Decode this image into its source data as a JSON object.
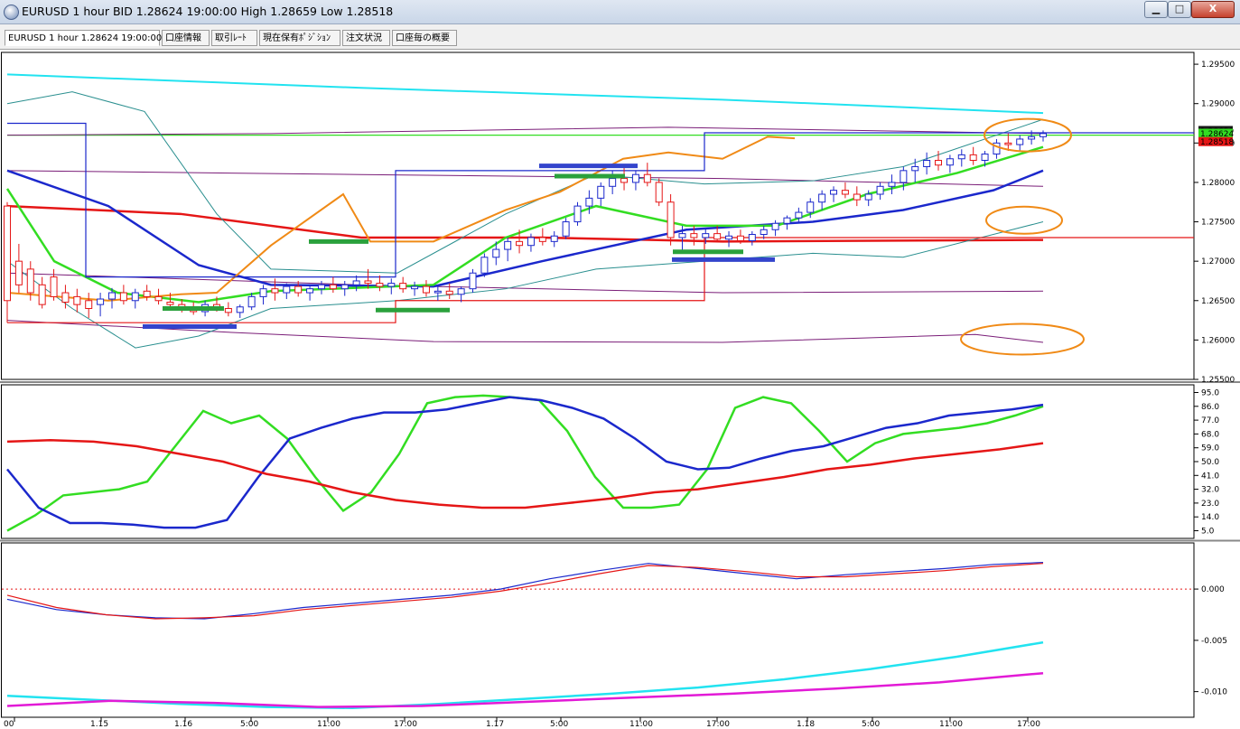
{
  "window": {
    "title": "EURUSD 1 hour BID 1.28624 19:00:00 High 1.28659 Low 1.28518",
    "minimize_glyph": "▁",
    "maximize_glyph": "□",
    "close_glyph": "X"
  },
  "tabs": [
    {
      "label": "EURUSD 1 hour 1.28624 19:00:00",
      "active": true
    },
    {
      "label": "口座情報",
      "active": false
    },
    {
      "label": "取引ﾚｰﾄ",
      "active": false
    },
    {
      "label": "現在保有ﾎﾟｼﾞｼｮﾝ",
      "active": false
    },
    {
      "label": "注文状況",
      "active": false
    },
    {
      "label": "口座毎の概要",
      "active": false
    }
  ],
  "chart_data": [
    {
      "type": "candlestick",
      "panel": "price",
      "ylim": [
        1.255,
        1.2965
      ],
      "y_ticks": [
        "1.29500",
        "1.29000",
        "1.28500",
        "1.28000",
        "1.27500",
        "1.27000",
        "1.26500",
        "1.26000",
        "1.25500"
      ],
      "current_price_labels": [
        "1.28659",
        "1.28624",
        "1.28518"
      ],
      "candles": [
        [
          1.277,
          1.2775,
          1.2622,
          1.265
        ],
        [
          1.27,
          1.2722,
          1.266,
          1.267
        ],
        [
          1.269,
          1.27,
          1.265,
          1.266
        ],
        [
          1.267,
          1.268,
          1.264,
          1.2645
        ],
        [
          1.268,
          1.269,
          1.265,
          1.2655
        ],
        [
          1.266,
          1.267,
          1.264,
          1.2648
        ],
        [
          1.2655,
          1.2665,
          1.2635,
          1.2645
        ],
        [
          1.265,
          1.266,
          1.2628,
          1.264
        ],
        [
          1.2645,
          1.266,
          1.263,
          1.2652
        ],
        [
          1.2652,
          1.2666,
          1.264,
          1.266
        ],
        [
          1.266,
          1.267,
          1.2645,
          1.265
        ],
        [
          1.265,
          1.2665,
          1.264,
          1.266
        ],
        [
          1.2662,
          1.267,
          1.265,
          1.2655
        ],
        [
          1.2655,
          1.2665,
          1.2645,
          1.265
        ],
        [
          1.2648,
          1.266,
          1.2638,
          1.2645
        ],
        [
          1.2645,
          1.2652,
          1.2635,
          1.264
        ],
        [
          1.264,
          1.2648,
          1.2632,
          1.2636
        ],
        [
          1.2636,
          1.265,
          1.263,
          1.2645
        ],
        [
          1.2645,
          1.2655,
          1.2636,
          1.264
        ],
        [
          1.264,
          1.2648,
          1.263,
          1.2635
        ],
        [
          1.2635,
          1.2645,
          1.2628,
          1.2642
        ],
        [
          1.2642,
          1.266,
          1.2638,
          1.2655
        ],
        [
          1.2655,
          1.267,
          1.2645,
          1.2665
        ],
        [
          1.2665,
          1.2678,
          1.265,
          1.266
        ],
        [
          1.266,
          1.2672,
          1.2652,
          1.2668
        ],
        [
          1.2668,
          1.2675,
          1.2655,
          1.266
        ],
        [
          1.266,
          1.267,
          1.265,
          1.2665
        ],
        [
          1.2665,
          1.2675,
          1.2658,
          1.267
        ],
        [
          1.267,
          1.268,
          1.266,
          1.2665
        ],
        [
          1.2665,
          1.2675,
          1.2656,
          1.267
        ],
        [
          1.267,
          1.2682,
          1.2662,
          1.2675
        ],
        [
          1.2675,
          1.269,
          1.2665,
          1.2672
        ],
        [
          1.2672,
          1.2682,
          1.2662,
          1.2668
        ],
        [
          1.2668,
          1.2678,
          1.2658,
          1.2672
        ],
        [
          1.2672,
          1.268,
          1.266,
          1.2665
        ],
        [
          1.2665,
          1.2674,
          1.2656,
          1.2668
        ],
        [
          1.2668,
          1.2676,
          1.2655,
          1.266
        ],
        [
          1.266,
          1.2668,
          1.265,
          1.2662
        ],
        [
          1.2662,
          1.2672,
          1.2652,
          1.2658
        ],
        [
          1.2658,
          1.2668,
          1.2648,
          1.2665
        ],
        [
          1.2665,
          1.269,
          1.266,
          1.2685
        ],
        [
          1.2685,
          1.271,
          1.268,
          1.2705
        ],
        [
          1.2705,
          1.2725,
          1.2695,
          1.2715
        ],
        [
          1.2715,
          1.273,
          1.27,
          1.2725
        ],
        [
          1.2725,
          1.274,
          1.271,
          1.272
        ],
        [
          1.272,
          1.2735,
          1.2712,
          1.273
        ],
        [
          1.273,
          1.2742,
          1.272,
          1.2725
        ],
        [
          1.2725,
          1.2738,
          1.2718,
          1.2732
        ],
        [
          1.2732,
          1.2755,
          1.2728,
          1.275
        ],
        [
          1.275,
          1.2775,
          1.2745,
          1.277
        ],
        [
          1.277,
          1.279,
          1.276,
          1.278
        ],
        [
          1.278,
          1.28,
          1.277,
          1.2795
        ],
        [
          1.2795,
          1.2815,
          1.2785,
          1.2805
        ],
        [
          1.2805,
          1.282,
          1.279,
          1.28
        ],
        [
          1.28,
          1.2815,
          1.279,
          1.281
        ],
        [
          1.281,
          1.2825,
          1.2795,
          1.28
        ],
        [
          1.28,
          1.2805,
          1.277,
          1.2775
        ],
        [
          1.2775,
          1.2785,
          1.272,
          1.273
        ],
        [
          1.273,
          1.2745,
          1.2712,
          1.2735
        ],
        [
          1.2735,
          1.2745,
          1.272,
          1.273
        ],
        [
          1.273,
          1.2742,
          1.2722,
          1.2735
        ],
        [
          1.2735,
          1.2745,
          1.2725,
          1.2728
        ],
        [
          1.2728,
          1.2738,
          1.2718,
          1.2732
        ],
        [
          1.2732,
          1.274,
          1.2722,
          1.2726
        ],
        [
          1.2726,
          1.2738,
          1.272,
          1.2734
        ],
        [
          1.2734,
          1.2745,
          1.2728,
          1.274
        ],
        [
          1.274,
          1.2752,
          1.2732,
          1.2748
        ],
        [
          1.2748,
          1.2758,
          1.274,
          1.2755
        ],
        [
          1.2755,
          1.2768,
          1.2748,
          1.2762
        ],
        [
          1.2762,
          1.278,
          1.2755,
          1.2775
        ],
        [
          1.2775,
          1.279,
          1.2765,
          1.2785
        ],
        [
          1.2785,
          1.2795,
          1.2775,
          1.279
        ],
        [
          1.279,
          1.28,
          1.278,
          1.2785
        ],
        [
          1.2785,
          1.2795,
          1.277,
          1.2778
        ],
        [
          1.2778,
          1.279,
          1.277,
          1.2785
        ],
        [
          1.2785,
          1.28,
          1.2778,
          1.2795
        ],
        [
          1.2795,
          1.281,
          1.2785,
          1.28
        ],
        [
          1.28,
          1.282,
          1.279,
          1.2815
        ],
        [
          1.2815,
          1.283,
          1.28,
          1.282
        ],
        [
          1.282,
          1.2838,
          1.281,
          1.2828
        ],
        [
          1.2828,
          1.284,
          1.2815,
          1.2822
        ],
        [
          1.2822,
          1.2835,
          1.2812,
          1.283
        ],
        [
          1.283,
          1.2842,
          1.282,
          1.2835
        ],
        [
          1.2835,
          1.2845,
          1.2822,
          1.2828
        ],
        [
          1.2828,
          1.284,
          1.282,
          1.2836
        ],
        [
          1.2836,
          1.2855,
          1.283,
          1.285
        ],
        [
          1.285,
          1.2862,
          1.284,
          1.2848
        ],
        [
          1.2848,
          1.286,
          1.284,
          1.2855
        ],
        [
          1.2855,
          1.2866,
          1.2848,
          1.2858
        ],
        [
          1.2858,
          1.2866,
          1.2852,
          1.2862
        ]
      ],
      "annotations": [
        "horizontal green and blue bars at support and resistance",
        "orange ellipses on the right"
      ]
    },
    {
      "type": "line",
      "panel": "oscillator",
      "ylim": [
        0,
        100
      ],
      "y_ticks": [
        "95.0",
        "86.0",
        "77.0",
        "68.0",
        "59.0",
        "50.0",
        "41.0",
        "32.0",
        "23.0",
        "14.0",
        "5.0"
      ],
      "series": [
        {
          "color": "#33dd22",
          "values": [
            5,
            15,
            28,
            30,
            32,
            37,
            60,
            83,
            75,
            80,
            65,
            40,
            18,
            30,
            55,
            88,
            92,
            93,
            92,
            90,
            70,
            40,
            20,
            20,
            22,
            45,
            85,
            92,
            88,
            70,
            50,
            62,
            68,
            70,
            72,
            75,
            80,
            86
          ]
        },
        {
          "color": "#1b28cc",
          "values": [
            45,
            20,
            10,
            10,
            9,
            7,
            7,
            12,
            40,
            65,
            72,
            78,
            82,
            82,
            84,
            88,
            92,
            90,
            85,
            78,
            65,
            50,
            45,
            46,
            52,
            57,
            60,
            66,
            72,
            75,
            80,
            82,
            84,
            87
          ]
        },
        {
          "color": "#e51616",
          "values": [
            63,
            64,
            63,
            60,
            55,
            50,
            42,
            37,
            30,
            25,
            22,
            20,
            20,
            23,
            26,
            30,
            32,
            36,
            40,
            45,
            48,
            52,
            55,
            58,
            62
          ]
        }
      ]
    },
    {
      "type": "line",
      "panel": "macd",
      "ylim": [
        -0.0125,
        0.0045
      ],
      "y_ticks": [
        "0.000",
        "-0.005",
        "-0.010"
      ],
      "series": [
        {
          "color": "#1b28cc",
          "values": [
            -0.001,
            -0.002,
            -0.0025,
            -0.0028,
            -0.0029,
            -0.0024,
            -0.0018,
            -0.0014,
            -0.001,
            -0.0006,
            0.0,
            0.001,
            0.0018,
            0.0025,
            0.002,
            0.0015,
            0.001,
            0.0014,
            0.0017,
            0.002,
            0.0024,
            0.0026
          ]
        },
        {
          "color": "#e51616",
          "values": [
            -0.0006,
            -0.0018,
            -0.0025,
            -0.0029,
            -0.0028,
            -0.0026,
            -0.002,
            -0.0016,
            -0.0012,
            -0.0008,
            -0.0002,
            0.0006,
            0.0015,
            0.0023,
            0.0021,
            0.0017,
            0.0012,
            0.0012,
            0.0015,
            0.0018,
            0.0022,
            0.0025
          ]
        },
        {
          "color": "#22e3f0",
          "values": [
            -0.0104,
            -0.0108,
            -0.0112,
            -0.0115,
            -0.0116,
            -0.0112,
            -0.0107,
            -0.0102,
            -0.0096,
            -0.0088,
            -0.0078,
            -0.0066,
            -0.0052
          ]
        },
        {
          "color": "#e21ad6",
          "values": [
            -0.0114,
            -0.0109,
            -0.0111,
            -0.0115,
            -0.0114,
            -0.011,
            -0.0106,
            -0.0102,
            -0.0097,
            -0.0091,
            -0.0082
          ]
        }
      ]
    }
  ],
  "x_labels": [
    "00",
    "1.15",
    "1.16",
    "5:00",
    "11:00",
    "17:00",
    "1.17",
    "5:00",
    "11:00",
    "17:00",
    "1.18",
    "5:00",
    "11:00",
    "17:00"
  ]
}
